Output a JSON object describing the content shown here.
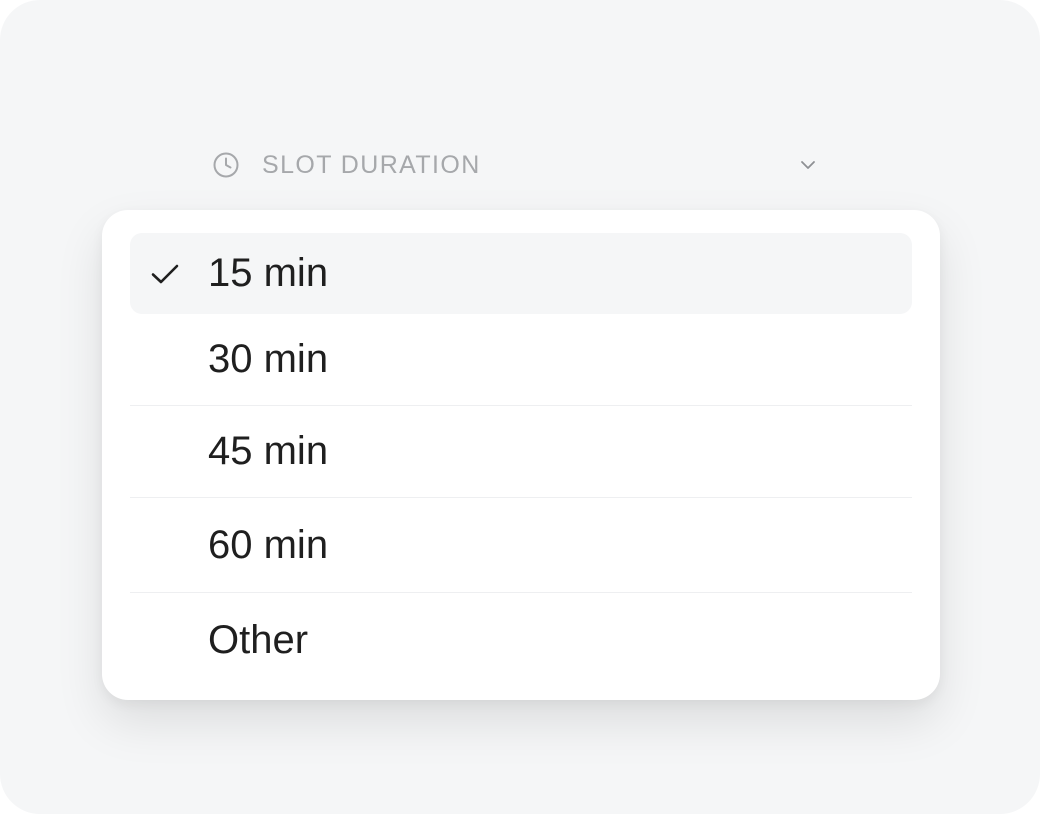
{
  "field": {
    "label": "SLOT DURATION",
    "icon": "clock-icon",
    "chevron_icon": "chevron-down-icon"
  },
  "menu": {
    "options": [
      {
        "label": "15 min",
        "selected": true
      },
      {
        "label": "30 min",
        "selected": false
      },
      {
        "label": "45 min",
        "selected": false
      },
      {
        "label": "60 min",
        "selected": false
      },
      {
        "label": "Other",
        "selected": false
      }
    ],
    "check_icon": "checkmark-icon"
  },
  "colors": {
    "background": "#f5f6f7",
    "menu_surface": "#ffffff",
    "selected_row": "#f5f6f7",
    "muted_text": "#a6a8ab",
    "option_text": "#1f1f1f"
  }
}
